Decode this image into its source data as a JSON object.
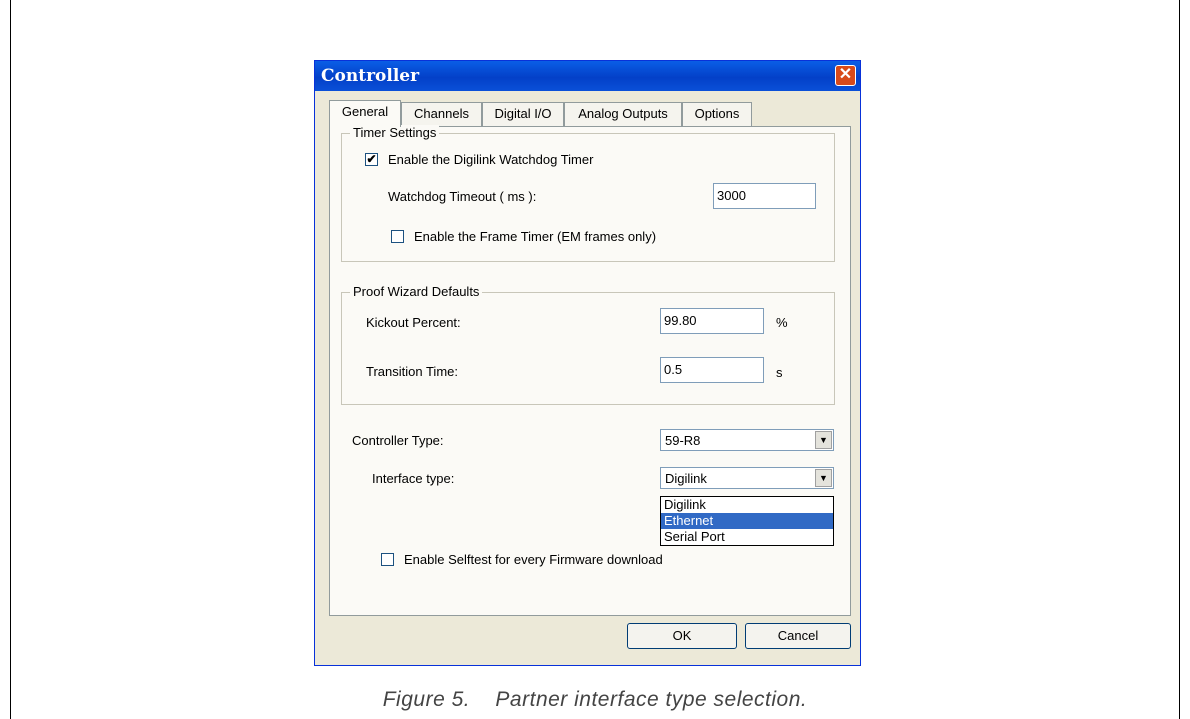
{
  "window": {
    "title": "Controller"
  },
  "tabs": [
    "General",
    "Channels",
    "Digital I/O",
    "Analog Outputs",
    "Options"
  ],
  "timer_settings": {
    "legend": "Timer Settings",
    "enable_watchdog_label": "Enable the Digilink Watchdog Timer",
    "enable_watchdog_checked_glyph": "✔",
    "watchdog_timeout_label": "Watchdog Timeout ( ms ):",
    "watchdog_timeout_value": "3000",
    "frame_timer_label": "Enable the Frame Timer (EM frames only)"
  },
  "proof_wizard": {
    "legend": "Proof Wizard Defaults",
    "kickout_label": "Kickout Percent:",
    "kickout_value": "99.80",
    "kickout_unit": "%",
    "transition_label": "Transition Time:",
    "transition_value": "0.5",
    "transition_unit": "s"
  },
  "controller_type": {
    "label": "Controller Type:",
    "value": "59-R8"
  },
  "interface_type": {
    "label": "Interface type:",
    "value": "Digilink",
    "options": [
      "Digilink",
      "Ethernet",
      "Serial Port"
    ],
    "highlighted": "Ethernet"
  },
  "selftest_label": "Enable Selftest for every Firmware download",
  "buttons": {
    "ok": "OK",
    "cancel": "Cancel"
  },
  "caption": "Figure 5.    Partner interface type selection.",
  "icons": {
    "close": "close-icon",
    "dropdown_arrow": "chevron-down-icon",
    "check": "checkmark-icon"
  }
}
